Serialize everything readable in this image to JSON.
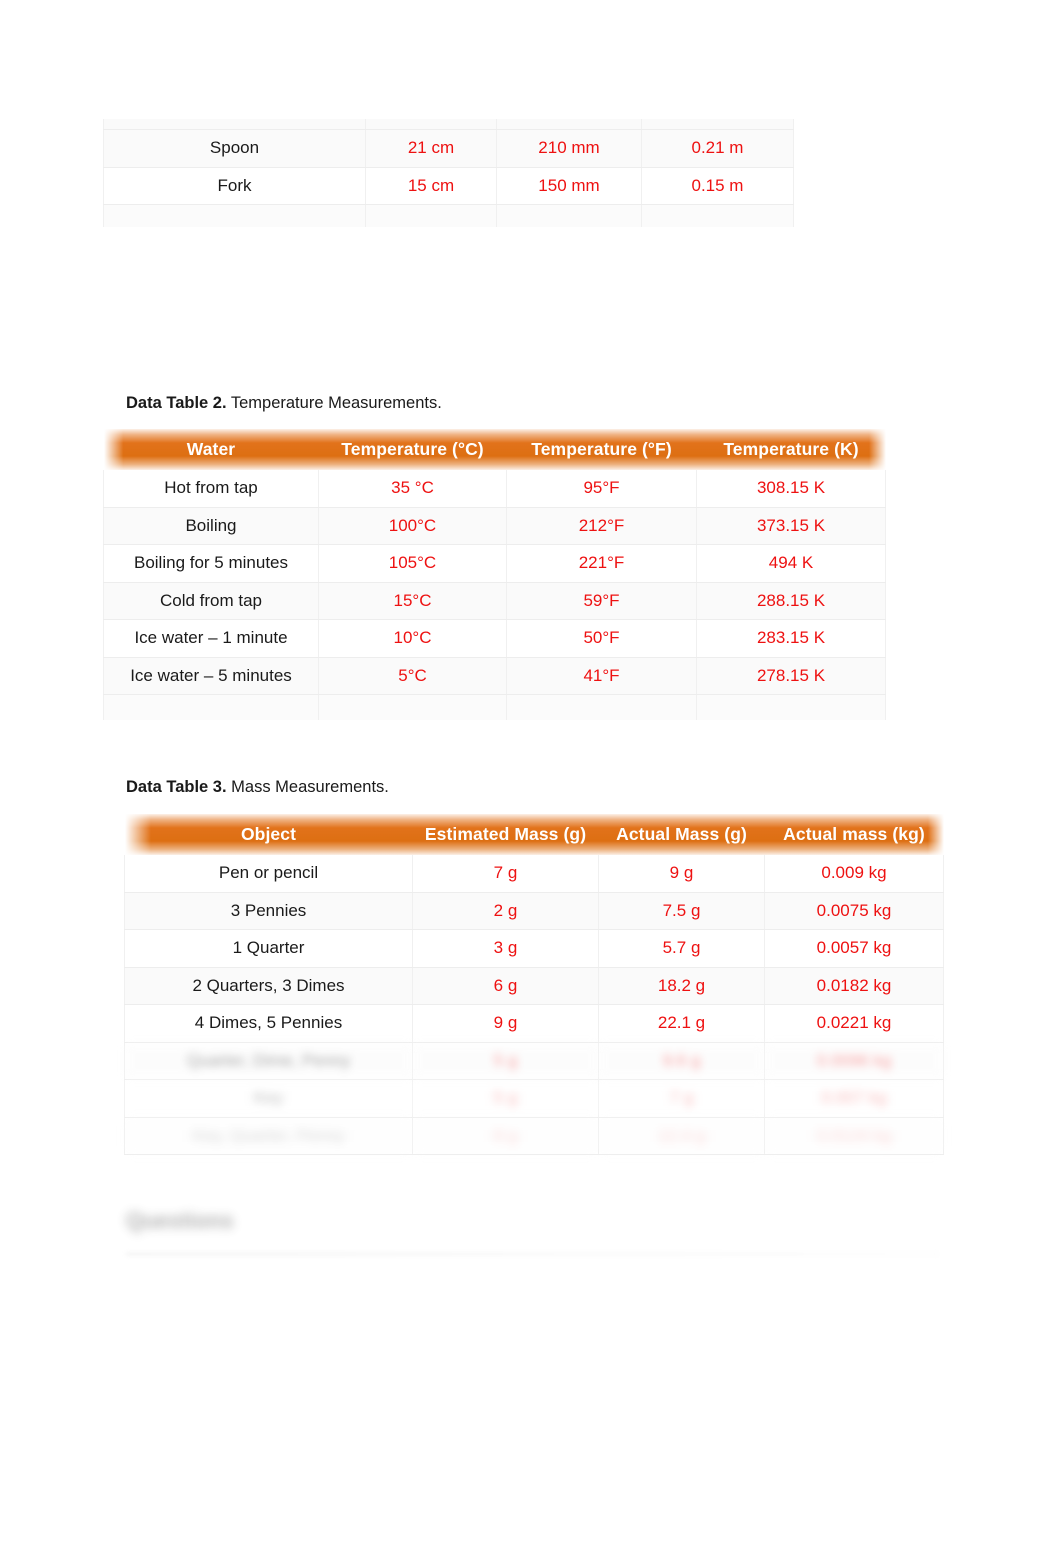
{
  "document": {
    "accent_color": "#e2721b",
    "value_color": "#ee1111",
    "text_color": "#1a1a1a"
  },
  "table_one": {
    "rows": [
      {
        "object": "Spoon",
        "cm": "21 cm",
        "mm": "210 mm",
        "m": "0.21 m"
      },
      {
        "object": "Fork",
        "cm": "15 cm",
        "mm": "150 mm",
        "m": "0.15 m"
      }
    ]
  },
  "table_two": {
    "caption_label": "Data Table 2.",
    "caption_text": " Temperature Measurements.",
    "headers": [
      "Water",
      "Temperature (°C)",
      "Temperature (°F)",
      "Temperature (K)"
    ],
    "rows": [
      {
        "water": "Hot from tap",
        "c": "35 °C",
        "f": "95°F",
        "k": "308.15 K"
      },
      {
        "water": "Boiling",
        "c": "100°C",
        "f": "212°F",
        "k": "373.15 K"
      },
      {
        "water": "Boiling for 5 minutes",
        "c": "105°C",
        "f": "221°F",
        "k": "494 K"
      },
      {
        "water": "Cold from tap",
        "c": "15°C",
        "f": "59°F",
        "k": "288.15 K"
      },
      {
        "water": "Ice water – 1 minute",
        "c": "10°C",
        "f": "50°F",
        "k": "283.15 K"
      },
      {
        "water": "Ice water – 5 minutes",
        "c": "5°C",
        "f": "41°F",
        "k": "278.15 K"
      }
    ]
  },
  "table_three": {
    "caption_label": "Data Table 3.",
    "caption_text": " Mass Measurements.",
    "headers": [
      "Object",
      "Estimated Mass (g)",
      "Actual Mass (g)",
      "Actual mass (kg)"
    ],
    "rows": [
      {
        "object": "Pen or pencil",
        "est": "7 g",
        "actual_g": "9 g",
        "actual_kg": "0.009 kg"
      },
      {
        "object": "3 Pennies",
        "est": "2 g",
        "actual_g": "7.5 g",
        "actual_kg": "0.0075 kg"
      },
      {
        "object": "1 Quarter",
        "est": "3 g",
        "actual_g": "5.7 g",
        "actual_kg": "0.0057 kg"
      },
      {
        "object": "2 Quarters, 3 Dimes",
        "est": "6 g",
        "actual_g": "18.2 g",
        "actual_kg": "0.0182 kg"
      },
      {
        "object": "4 Dimes, 5 Pennies",
        "est": "9 g",
        "actual_g": "22.1 g",
        "actual_kg": "0.0221 kg"
      }
    ],
    "obscured_rows": [
      {
        "object": "Quarter, Dime, Penny",
        "est": "5 g",
        "actual_g": "9.6 g",
        "actual_kg": "0.0096 kg"
      },
      {
        "object": "Key",
        "est": "5 g",
        "actual_g": "7 g",
        "actual_kg": "0.007 kg"
      },
      {
        "object": "Key, Quarter, Penny",
        "est": "8 g",
        "actual_g": "12.4 g",
        "actual_kg": "0.0124 kg"
      }
    ]
  },
  "questions_section": {
    "heading": "Questions"
  }
}
